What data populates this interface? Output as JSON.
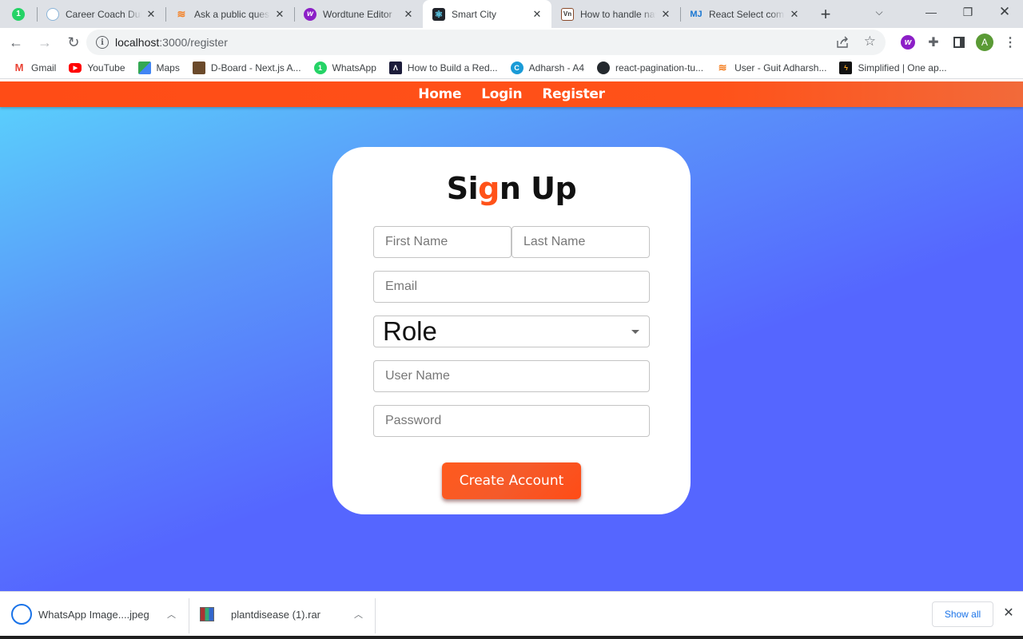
{
  "browser": {
    "pinned_tab": {
      "icon": "whatsapp-icon",
      "badge": "1"
    },
    "tabs": [
      {
        "title": "Career Coach Dubai",
        "icon": "career-coach-icon",
        "active": false
      },
      {
        "title": "Ask a public question",
        "icon": "stackoverflow-icon",
        "active": false
      },
      {
        "title": "Wordtune Editor",
        "icon": "wordtune-icon",
        "active": false
      },
      {
        "title": "Smart City",
        "icon": "react-icon",
        "active": true
      },
      {
        "title": "How to handle navigation",
        "icon": "vn-icon",
        "active": false
      },
      {
        "title": "React Select component",
        "icon": "mui-icon",
        "active": false
      }
    ],
    "url_host": "localhost",
    "url_path": ":3000/register",
    "avatar_letter": "A",
    "bookmarks": [
      {
        "label": "Gmail",
        "icon": "gmail-icon",
        "color": "#ea4335"
      },
      {
        "label": "YouTube",
        "icon": "youtube-icon",
        "color": "#ff0000"
      },
      {
        "label": "Maps",
        "icon": "maps-icon",
        "color": "#34a853"
      },
      {
        "label": "D-Board - Next.js A...",
        "icon": "dboard-icon",
        "color": "#6b4a2b"
      },
      {
        "label": "WhatsApp",
        "icon": "whatsapp-icon",
        "color": "#25d366"
      },
      {
        "label": "How to Build a Red...",
        "icon": "build-icon",
        "color": "#1c1c3a"
      },
      {
        "label": "Adharsh - A4",
        "icon": "canva-icon",
        "color": "#1a9bd7"
      },
      {
        "label": "react-pagination-tu...",
        "icon": "github-icon",
        "color": "#24292e"
      },
      {
        "label": "User - Guit Adharsh...",
        "icon": "stackoverflow-icon",
        "color": "#f48024"
      },
      {
        "label": "Simplified | One ap...",
        "icon": "simplified-icon",
        "color": "#111111"
      }
    ]
  },
  "app": {
    "nav": {
      "home": "Home",
      "login": "Login",
      "register": "Register"
    },
    "title_pre": "Si",
    "title_accent": "g",
    "title_post": "n Up",
    "fields": {
      "first_name": "First Name",
      "last_name": "Last Name",
      "email": "Email",
      "role": "Role",
      "user_name": "User Name",
      "password": "Password"
    },
    "submit": "Create Account",
    "colors": {
      "accent": "#ff5219",
      "bg_top": "#5ad4fc",
      "bg_bottom": "#5566ff"
    }
  },
  "downloads": {
    "items": [
      {
        "name": "WhatsApp Image....jpeg",
        "status": "in-progress"
      },
      {
        "name": "plantdisease (1).rar",
        "status": "complete"
      }
    ],
    "show_all": "Show all"
  }
}
